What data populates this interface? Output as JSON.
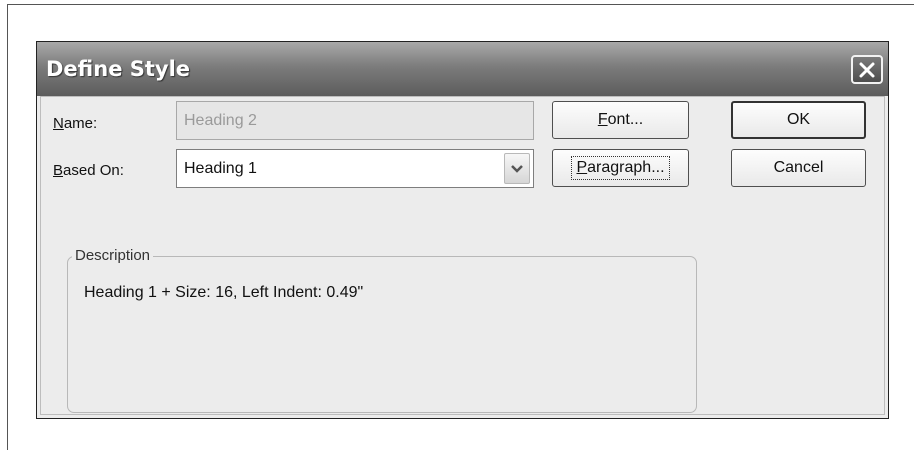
{
  "dialog": {
    "title": "Define Style",
    "close_icon": "close-icon"
  },
  "name_field": {
    "label_accel": "N",
    "label_rest": "ame:",
    "value": "Heading 2",
    "enabled": false
  },
  "based_on": {
    "label_accel": "B",
    "label_rest": "ased On:",
    "value": "Heading 1",
    "dropdown_icon": "chevron-down-icon"
  },
  "buttons": {
    "font_accel": "F",
    "font_rest": "ont...",
    "paragraph_accel": "P",
    "paragraph_rest": "aragraph...",
    "ok": "OK",
    "cancel": "Cancel"
  },
  "description": {
    "legend": "Description",
    "text": "Heading 1 + Size: 16, Left Indent: 0.49\""
  }
}
